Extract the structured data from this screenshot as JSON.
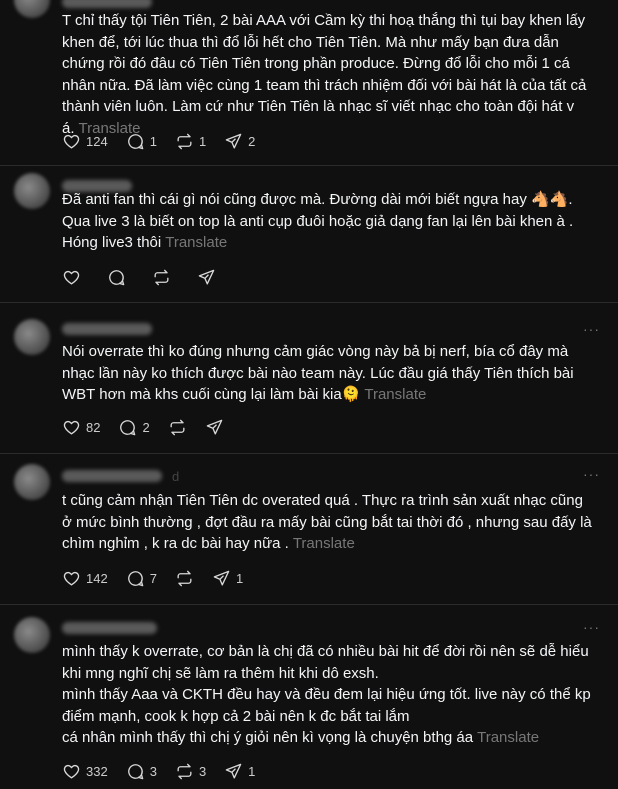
{
  "translate_label": "Translate",
  "more_label": "···",
  "posts": [
    {
      "text": "T chỉ thấy tội Tiên Tiên, 2 bài AAA với Cầm kỳ thi hoạ thắng thì tụi bay khen lấy khen để, tới lúc thua thì đổ lỗi hết cho Tiên Tiên. Mà như mấy bạn đưa dẫn chứng rồi đó đâu có Tiên Tiên trong phần produce. Đừng đổ lỗi cho mỗi 1 cá nhân nữa. Đã làm việc cùng 1 team thì trách nhiệm đối với bài hát là của tất cả thành viên luôn. Làm cứ như Tiên Tiên là nhạc sĩ viết nhạc cho toàn đội hát v á.",
      "likes": "124",
      "replies": "1",
      "reposts": "1",
      "shares": "2"
    },
    {
      "text": "Đã anti fan thì cái gì nói cũng được mà. Đường dài mới biết ngựa hay 🐴🐴. Qua live 3 là biết on top là anti cụp đuôi hoặc giả dạng fan lại lên bài khen à . Hóng live3 thôi",
      "likes": "",
      "replies": "",
      "reposts": "",
      "shares": ""
    },
    {
      "text": "Nói overrate thì ko đúng nhưng cảm giác vòng này bả bị nerf, bía cổ đây mà nhạc lần này ko thích được bài nào team này. Lúc đầu giá thấy Tiên thích bài WBT hơn mà khs cuối cùng lại làm bài kia🫠",
      "likes": "82",
      "replies": "2",
      "reposts": "",
      "shares": ""
    },
    {
      "text": "t cũng cảm nhận Tiên Tiên dc overated quá . Thực ra trình sản xuất nhạc cũng ở mức bình thường , đợt đầu ra mấy bài cũng bắt tai thời đó , nhưng sau đấy là chìm nghỉm , k ra dc bài hay nữa .",
      "likes": "142",
      "replies": "7",
      "reposts": "",
      "shares": "1",
      "name_suffix": "d"
    },
    {
      "text_lines": [
        "mình thấy k overrate, cơ bản là chị đã có nhiều bài hit để đời rồi nên sẽ dễ hiểu khi mng nghĩ chị sẽ làm ra thêm hit khi dô exsh.",
        "mình thấy Aaa và CKTH đều hay và đều đem lại hiệu ứng tốt. live này có thể kp điểm mạnh, cook k hợp cả 2 bài nên k đc bắt tai lắm",
        "cá nhân mình thấy thì chị ý giỏi nên kì vọng là chuyện bthg áa"
      ],
      "likes": "332",
      "replies": "3",
      "reposts": "3",
      "shares": "1"
    }
  ]
}
